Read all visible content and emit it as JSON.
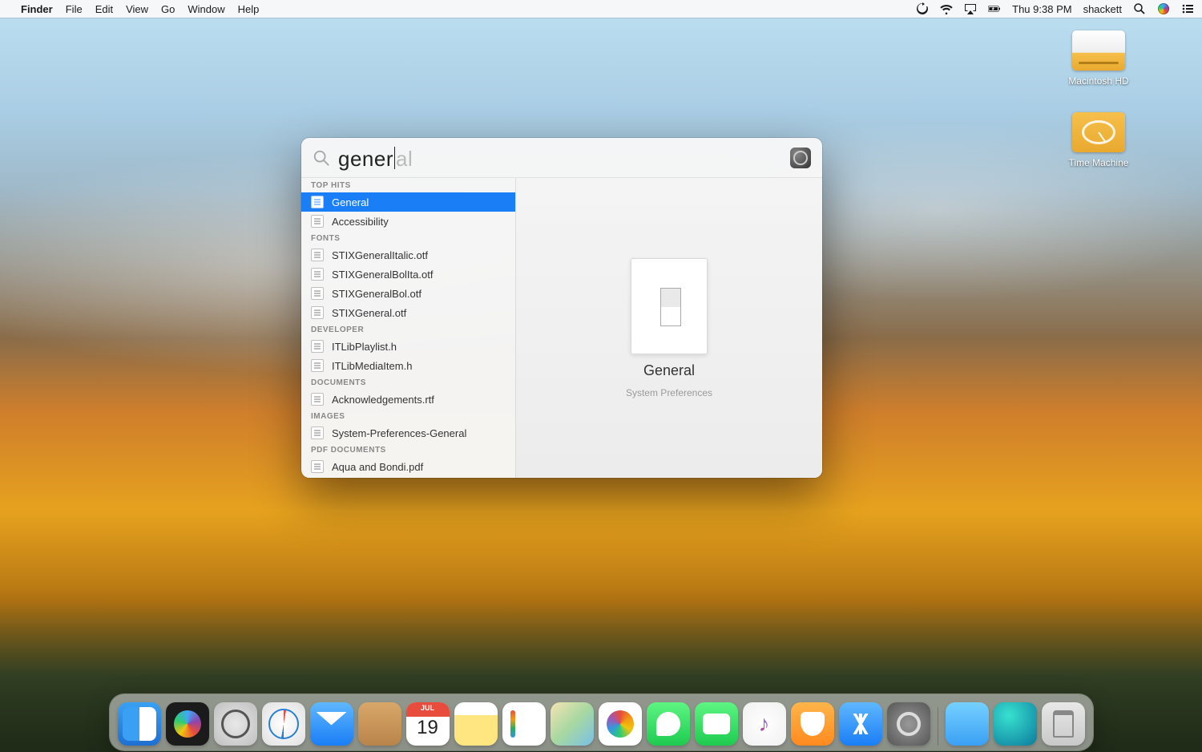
{
  "menubar": {
    "apple": "",
    "app": "Finder",
    "menus": [
      "File",
      "Edit",
      "View",
      "Go",
      "Window",
      "Help"
    ],
    "status": {
      "datetime": "Thu 9:38 PM",
      "user": "shackett"
    }
  },
  "desktop_icons": [
    {
      "label": "Macintosh HD"
    },
    {
      "label": "Time Machine"
    }
  ],
  "spotlight": {
    "query_typed": "gener",
    "query_suggestion": "al",
    "sections": [
      {
        "title": "TOP HITS",
        "items": [
          {
            "label": "General",
            "selected": true
          },
          {
            "label": "Accessibility"
          }
        ]
      },
      {
        "title": "FONTS",
        "items": [
          {
            "label": "STIXGeneralItalic.otf"
          },
          {
            "label": "STIXGeneralBolIta.otf"
          },
          {
            "label": "STIXGeneralBol.otf"
          },
          {
            "label": "STIXGeneral.otf"
          }
        ]
      },
      {
        "title": "DEVELOPER",
        "items": [
          {
            "label": "ITLibPlaylist.h"
          },
          {
            "label": "ITLibMediaItem.h"
          }
        ]
      },
      {
        "title": "DOCUMENTS",
        "items": [
          {
            "label": "Acknowledgements.rtf"
          }
        ]
      },
      {
        "title": "IMAGES",
        "items": [
          {
            "label": "System-Preferences-General"
          }
        ]
      },
      {
        "title": "PDF DOCUMENTS",
        "items": [
          {
            "label": "Aqua and Bondi.pdf"
          }
        ]
      }
    ],
    "preview": {
      "title": "General",
      "subtitle": "System Preferences"
    }
  },
  "dock": {
    "calendar": {
      "month": "JUL",
      "day": "19"
    },
    "apps": [
      "Finder",
      "Siri",
      "Launchpad",
      "Safari",
      "Mail",
      "Contacts",
      "Calendar",
      "Notes",
      "Reminders",
      "Maps",
      "Photos",
      "Messages",
      "FaceTime",
      "iTunes",
      "iBooks",
      "App Store",
      "System Preferences"
    ],
    "right": [
      "Recent Folder",
      "Website Link",
      "Trash"
    ]
  }
}
